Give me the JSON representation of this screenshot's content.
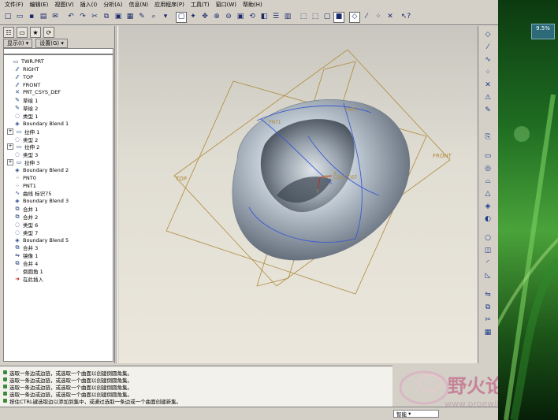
{
  "menu": [
    "文件(F)",
    "编辑(E)",
    "视图(V)",
    "插入(I)",
    "分析(A)",
    "信息(N)",
    "应用程序(P)",
    "工具(T)",
    "窗口(W)",
    "帮助(H)"
  ],
  "panel": {
    "show_label": "显示(I) ▾",
    "settings_label": "设置(G) ▾"
  },
  "tree": [
    {
      "label": "TWR.PRT",
      "icon": "part-icon",
      "indent": 0,
      "expand": false
    },
    {
      "label": "RIGHT",
      "icon": "datum-plane-icon",
      "indent": 1,
      "expand": false
    },
    {
      "label": "TOP",
      "icon": "datum-plane-icon",
      "indent": 1,
      "expand": false
    },
    {
      "label": "FRONT",
      "icon": "datum-plane-icon",
      "indent": 1,
      "expand": false
    },
    {
      "label": "PRT_CSYS_DEF",
      "icon": "csys-icon",
      "indent": 1,
      "expand": false
    },
    {
      "label": "草绘 1",
      "icon": "sketch-icon",
      "indent": 1,
      "expand": false
    },
    {
      "label": "草绘 2",
      "icon": "sketch-icon",
      "indent": 1,
      "expand": false
    },
    {
      "label": "类型 1",
      "icon": "surface-icon",
      "indent": 1,
      "expand": false
    },
    {
      "label": "Boundary Blend 1",
      "icon": "blend-icon",
      "indent": 1,
      "expand": false
    },
    {
      "label": "拉伸 1",
      "icon": "extrude-icon",
      "indent": 1,
      "expand": true
    },
    {
      "label": "类型 2",
      "icon": "surface-icon",
      "indent": 1,
      "expand": false
    },
    {
      "label": "拉伸 2",
      "icon": "extrude-icon",
      "indent": 1,
      "expand": true
    },
    {
      "label": "类型 3",
      "icon": "surface-icon",
      "indent": 1,
      "expand": false
    },
    {
      "label": "拉伸 3",
      "icon": "extrude-icon",
      "indent": 1,
      "expand": true
    },
    {
      "label": "Boundary Blend 2",
      "icon": "blend-icon",
      "indent": 1,
      "expand": false
    },
    {
      "label": "PNT0",
      "icon": "point-icon",
      "indent": 1,
      "expand": false
    },
    {
      "label": "PNT1",
      "icon": "point-icon",
      "indent": 1,
      "expand": false
    },
    {
      "label": "曲线 标识75",
      "icon": "curve-icon",
      "indent": 1,
      "expand": false
    },
    {
      "label": "Boundary Blend 3",
      "icon": "blend-icon",
      "indent": 1,
      "expand": false
    },
    {
      "label": "合并 1",
      "icon": "merge-icon",
      "indent": 1,
      "expand": false
    },
    {
      "label": "合并 2",
      "icon": "merge-icon",
      "indent": 1,
      "expand": false
    },
    {
      "label": "类型 6",
      "icon": "surface-icon",
      "indent": 1,
      "expand": false
    },
    {
      "label": "类型 7",
      "icon": "surface-icon",
      "indent": 1,
      "expand": false
    },
    {
      "label": "Boundary Blend 5",
      "icon": "blend-icon",
      "indent": 1,
      "expand": false
    },
    {
      "label": "合并 3",
      "icon": "merge-icon",
      "indent": 1,
      "expand": false
    },
    {
      "label": "镜像 1",
      "icon": "mirror-icon",
      "indent": 1,
      "expand": false
    },
    {
      "label": "合并 4",
      "icon": "merge-icon",
      "indent": 1,
      "expand": false
    },
    {
      "label": "倒圆角 1",
      "icon": "round-icon",
      "indent": 1,
      "expand": false
    },
    {
      "label": "在此插入",
      "icon": "insert-here-icon",
      "indent": 1,
      "expand": false
    }
  ],
  "viewport": {
    "labels": {
      "top": "TOP",
      "front": "FRONT",
      "pnt0": "PNT0",
      "pnt1": "PNT1",
      "csys": "PRT_CSYS_DEF",
      "x": "X",
      "y": "Y"
    }
  },
  "messages": [
    "选取一条边或边链，或选取一个曲面以创建倒圆角集。",
    "选取一条边或边链，或选取一个曲面以创建倒圆角集。",
    "选取一条边或边链，或选取一个曲面以创建倒圆角集。",
    "选取一条边或边链，或选取一个曲面以创建倒圆角集。",
    "按住CTRL键选取边以添加到集中，或通过选取一条边或一个曲面创建新集。"
  ],
  "status": {
    "filter": "智能"
  },
  "watermark": {
    "title": "野火论坛",
    "url": "www.proewildfire.cn"
  },
  "desktop": {
    "gadget": "9.5%"
  },
  "colors": {
    "surface": "#b8c4d0",
    "datum": "#b08a3a",
    "sketch": "#3a5ad0"
  }
}
